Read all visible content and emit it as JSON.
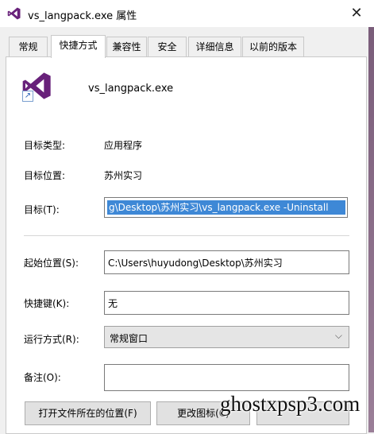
{
  "window": {
    "title": "vs_langpack.exe 属性",
    "close_glyph": "✕",
    "icon": "visual-studio-icon"
  },
  "tabs": [
    {
      "label": "常规"
    },
    {
      "label": "快捷方式",
      "active": true
    },
    {
      "label": "兼容性"
    },
    {
      "label": "安全"
    },
    {
      "label": "详细信息"
    },
    {
      "label": "以前的版本"
    }
  ],
  "header": {
    "filename": "vs_langpack.exe",
    "shortcut_glyph": "↗"
  },
  "info": {
    "target_type_label": "目标类型:",
    "target_type_value": "应用程序",
    "target_location_label": "目标位置:",
    "target_location_value": "苏州实习",
    "target_label": "目标(T):",
    "target_value": "g\\Desktop\\苏州实习\\vs_langpack.exe -Uninstall"
  },
  "form": {
    "start_in_label": "起始位置(S):",
    "start_in_value": "C:\\Users\\huyudong\\Desktop\\苏州实习",
    "hotkey_label": "快捷键(K):",
    "hotkey_value": "无",
    "run_label": "运行方式(R):",
    "run_value": "常规窗口",
    "run_chevron": "⌵",
    "comment_label": "备注(O):",
    "comment_value": ""
  },
  "buttons": {
    "open_location": "打开文件所在的位置(F)",
    "change_icon": "更改图标(C)"
  },
  "watermark": "ghostxpsp3.com",
  "colors": {
    "accent": "#3e88d6",
    "vs_purple": "#68217a"
  }
}
